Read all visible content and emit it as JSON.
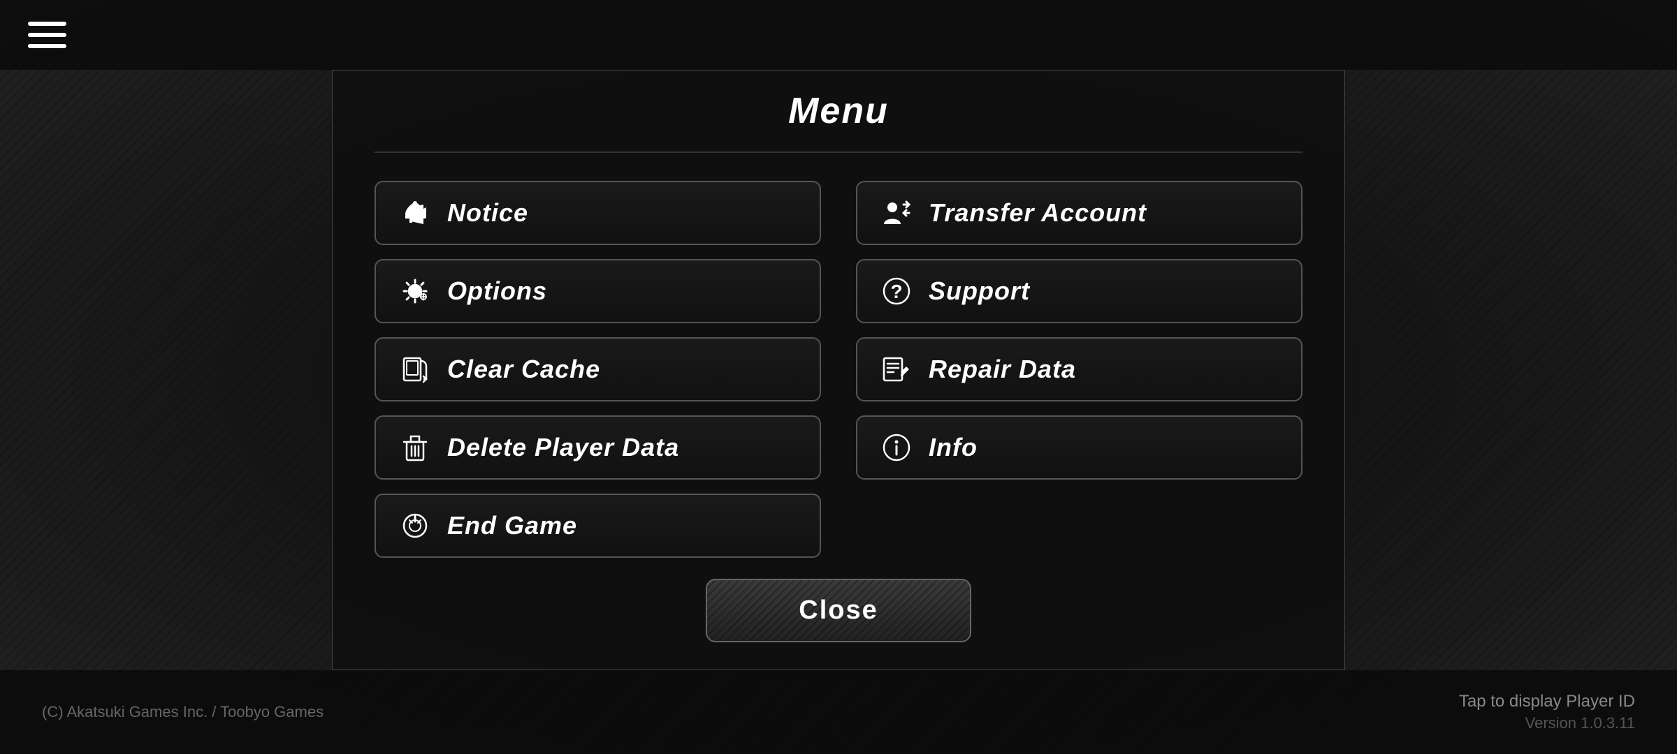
{
  "topbar": {
    "hamburger_label": "menu"
  },
  "dialog": {
    "title": "Menu",
    "buttons_left": [
      {
        "id": "notice",
        "label": "Notice",
        "icon": "notice-icon"
      },
      {
        "id": "options",
        "label": "Options",
        "icon": "options-icon"
      },
      {
        "id": "clear-cache",
        "label": "Clear Cache",
        "icon": "clear-cache-icon"
      },
      {
        "id": "delete-player-data",
        "label": "Delete Player Data",
        "icon": "delete-icon"
      },
      {
        "id": "end-game",
        "label": "End Game",
        "icon": "end-game-icon"
      }
    ],
    "buttons_right": [
      {
        "id": "transfer-account",
        "label": "Transfer Account",
        "icon": "transfer-icon"
      },
      {
        "id": "support",
        "label": "Support",
        "icon": "support-icon"
      },
      {
        "id": "repair-data",
        "label": "Repair Data",
        "icon": "repair-icon"
      },
      {
        "id": "info",
        "label": "Info",
        "icon": "info-icon"
      }
    ],
    "close_label": "Close"
  },
  "bottombar": {
    "copyright": "(C) Akatsuki Games Inc. / Toobyo Games",
    "player_id_prompt": "Tap to display Player ID",
    "version": "Version 1.0.3.11"
  }
}
